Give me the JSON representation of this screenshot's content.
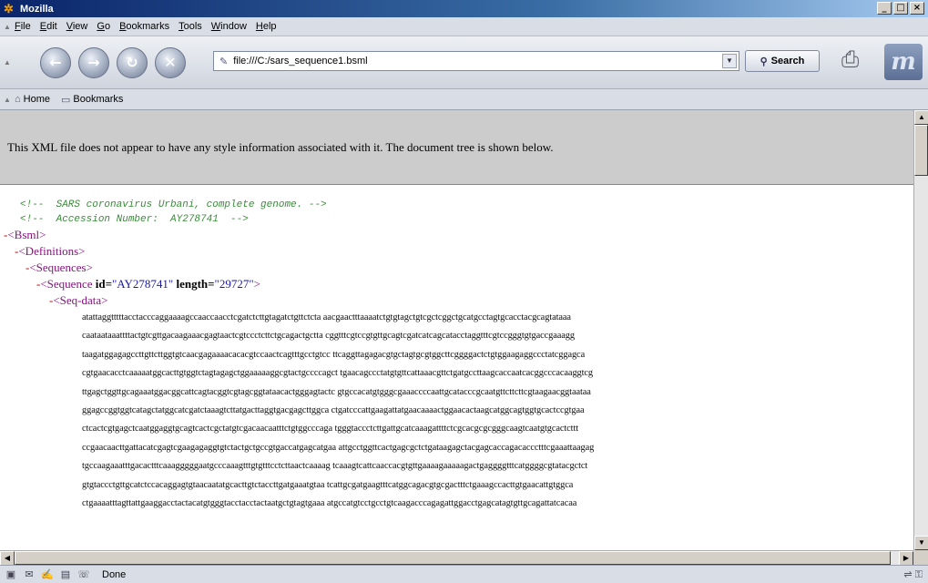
{
  "window": {
    "title": "Mozilla",
    "controls": [
      "_",
      "□",
      "×"
    ]
  },
  "menu": [
    {
      "prefix": "",
      "key": "F",
      "rest": "ile"
    },
    {
      "prefix": "",
      "key": "E",
      "rest": "dit"
    },
    {
      "prefix": "",
      "key": "V",
      "rest": "iew"
    },
    {
      "prefix": "",
      "key": "G",
      "rest": "o"
    },
    {
      "prefix": "",
      "key": "B",
      "rest": "ookmarks"
    },
    {
      "prefix": "",
      "key": "T",
      "rest": "ools"
    },
    {
      "prefix": "",
      "key": "W",
      "rest": "indow"
    },
    {
      "prefix": "",
      "key": "H",
      "rest": "elp"
    }
  ],
  "nav": {
    "url": "file:///C:/sars_sequence1.bsml",
    "search_label": "Search",
    "back_glyph": "←",
    "forward_glyph": "→",
    "reload_glyph": "↻",
    "stop_glyph": "✕",
    "throbber_label": "m"
  },
  "bookmarks_bar": {
    "home": "Home",
    "bookmarks": "Bookmarks"
  },
  "info_banner": "This XML file does not appear to have any style information associated with it. The document tree is shown below.",
  "xml": {
    "comment1": "<!--  SARS coronavirus Urbani, complete genome. -->",
    "comment2": "<!--  Accession Number:  AY278741  -->",
    "bsml": "<Bsml>",
    "definitions": "<Definitions>",
    "sequences": "<Sequences>",
    "sequence_open": "<Sequence",
    "attr_id": "id=",
    "val_id": "\"AY278741\"",
    "attr_length": "length=",
    "val_length": "\"29727\"",
    "sequence_close": ">",
    "seqdata": "<Seq-data>",
    "dash": "-",
    "lines": [
      "atattaggtttttacctacccaggaaaagccaaccaacctcgatctcttgtagatctgttctcta aacgaactttaaaatctgtgtagctgtcgctcggctgcatgcctagtgcacctacgcagtataaa",
      "caataataaattttactgtcgttgacaagaaacgagtaactcgtccctcttctgcagactgctta cggtttcgtccgtgttgcagtcgatcatcagcatacctaggtttcgtccgggtgtgaccgaaagg",
      "taagatggagagccttgttcttggtgtcaacgagaaaacacacgtccaactcagtttgcctgtcc ttcaggttagagacgtgctagtgcgtggcttcggggactctgtggaagaggccctatcggagca",
      "cgtgaacacctcaaaaatggcacttgtggtctagtagagctggaaaaaggcgtactgccccagct tgaacagccctatgtgttcattaaacgttctgatgccttaagcaccaatcacggcccacaaggtcg",
      "ttgagctggttgcagaaatggacggcattcagtacggtcgtagcggtataacactgggagtactc gtgccacatgtgggcgaaaccccaattgcatacccgcaatgttcttcttcgtaagaacggtaataa",
      "ggagccggtggtcatagctatggcatcgatctaaagtcttatgacttaggtgacgagcttggca ctgatcccattgaagattatgaacaaaactggaacactaagcatggcagtggtgcactccgtgaa",
      "ctcactcgtgagctcaatggaggtgcagtcactcgctatgtcgacaacaatttctgtggcccaga tgggtaccctcttgattgcatcaaagattttctcgcacgcgcgggcaagtcaatgtgcactcttt",
      "ccgaacaacttgattacatcgagtcgaagagaggtgtctactgctgccgtgaccatgagcatgaa attgcctggttcactgagcgctctgataagagctacgagcaccagacaccctttcgaaattaagag",
      "tgccaagaaatttgacactttcaaagggggaatgcccaaagtttgtgtttcctcttaactcaaaag tcaaagtcattcaaccacgtgttgaaaagaaaaagactgaggggtttcatggggcgtatacgctct",
      "gtgtaccctgttgcatctccacaggagtgtaacaatatgcacttgtctaccttgatgaaatgtaa tcattgcgatgaagtttcatggcagacgtgcgactttctgaaagccacttgtgaacattgtggca",
      "ctgaaaatttagttattgaaggacctactacatgtgggtacctacctactaatgctgtagtgaaa atgccatgtcctgcctgtcaagacccagagattggacctgagcatagtgttgcagattatcacaa"
    ]
  },
  "statusbar": {
    "status": "Done"
  }
}
